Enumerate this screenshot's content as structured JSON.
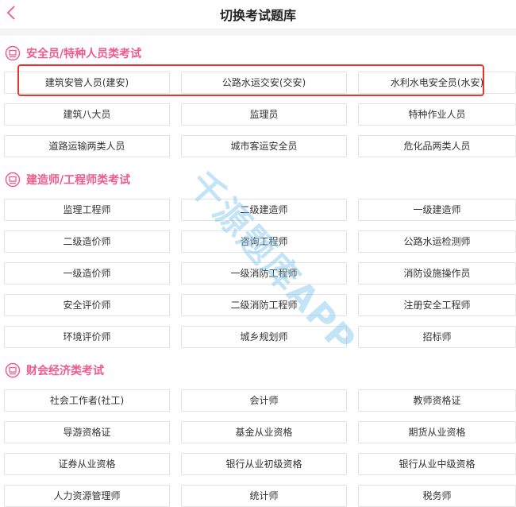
{
  "header": {
    "title": "切换考试题库",
    "back_icon": "chevron-left-icon"
  },
  "accent_color": "#ef5a8f",
  "highlight_color": "#e8332e",
  "watermark": "千源题库APP",
  "sections": [
    {
      "title": "安全员/特种人员类考试",
      "items": [
        "建筑安管人员(建安)",
        "公路水运交安(交安)",
        "水利水电安全员(水安)",
        "建筑八大员",
        "监理员",
        "特种作业人员",
        "道路运输两类人员",
        "城市客运安全员",
        "危化品两类人员"
      ]
    },
    {
      "title": "建造师/工程师类考试",
      "items": [
        "监理工程师",
        "二级建造师",
        "一级建造师",
        "二级造价师",
        "咨询工程师",
        "公路水运检测师",
        "一级造价师",
        "一级消防工程师",
        "消防设施操作员",
        "安全评价师",
        "二级消防工程师",
        "注册安全工程师",
        "环境评价师",
        "城乡规划师",
        "招标师"
      ]
    },
    {
      "title": "财会经济类考试",
      "items": [
        "社会工作者(社工)",
        "会计师",
        "教师资格证",
        "导游资格证",
        "基金从业资格",
        "期货从业资格",
        "证券从业资格",
        "银行从业初级资格",
        "银行从业中级资格",
        "人力资源管理师",
        "统计师",
        "税务师"
      ]
    }
  ]
}
